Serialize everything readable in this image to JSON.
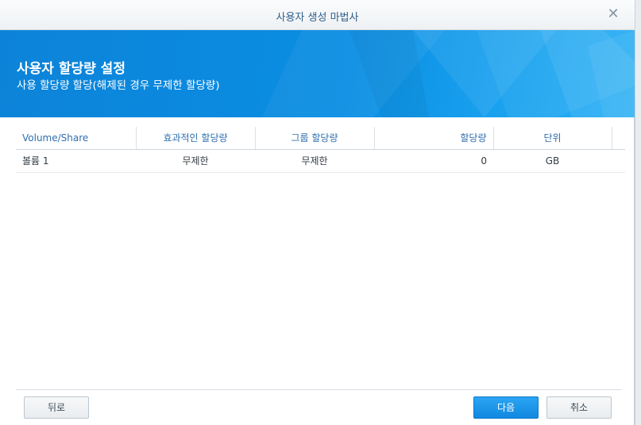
{
  "window": {
    "title": "사용자 생성 마법사",
    "close_icon": "close-icon"
  },
  "banner": {
    "title": "사용자 할당량 설정",
    "subtitle": "사용 할당량 할당(해제된 경우 무제한 할당량)"
  },
  "table": {
    "headers": [
      "Volume/Share",
      "효과적인 할당량",
      "그룹 할당량",
      "할당량",
      "단위"
    ],
    "rows": [
      {
        "volume": "볼륨 1",
        "effective_quota": "무제한",
        "group_quota": "무제한",
        "quota": "0",
        "unit": "GB"
      }
    ]
  },
  "buttons": {
    "back": "뒤로",
    "next": "다음",
    "cancel": "취소"
  },
  "colors": {
    "accent": "#0a8ee3",
    "header_text": "#2f6fae",
    "primary_button": "#1a94e8"
  }
}
